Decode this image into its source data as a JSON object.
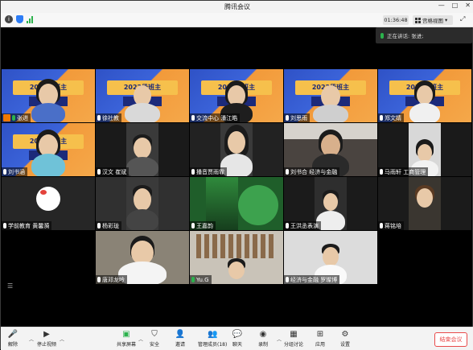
{
  "window": {
    "title": "腾讯会议"
  },
  "infobar": {
    "timer": "01:36:48",
    "view_label": "宫格视图"
  },
  "speaking": {
    "label": "正在讲话: 张进;"
  },
  "tiles": [
    {
      "name": "张进",
      "style": "banner",
      "host": true
    },
    {
      "name": "徐社教",
      "style": "banner"
    },
    {
      "name": "交流中心 潘江皓",
      "style": "banner"
    },
    {
      "name": "刘思雨",
      "style": "banner"
    },
    {
      "name": "郑文婧",
      "style": "banner"
    },
    {
      "name": "刘书涵",
      "style": "banner"
    },
    {
      "name": "汉文 崔斌",
      "style": "dark"
    },
    {
      "name": "播音贾雨霏",
      "style": "dark"
    },
    {
      "name": "刘书合 经济与金融",
      "style": "room"
    },
    {
      "name": "马雨轩 工商管理",
      "style": "dark"
    },
    {
      "name": "学前教育 黄馨漪",
      "style": "avatar"
    },
    {
      "name": "杨彩珑",
      "style": "dark"
    },
    {
      "name": "王嘉韵",
      "style": "green"
    },
    {
      "name": "王洪丞表演",
      "style": "dark"
    },
    {
      "name": "蒋铭培",
      "style": "dark"
    },
    {
      "name": "唐邓龙吟",
      "style": "room"
    },
    {
      "name": "Yu.G",
      "style": "shelf"
    },
    {
      "name": "经济与金融 罗璨博",
      "style": "bright"
    }
  ],
  "toolbar": {
    "mute": "解除",
    "video": "停止视频",
    "share": "共享屏幕",
    "security": "安全",
    "invite": "邀请",
    "members": "管理成员(18)",
    "chat": "聊天",
    "record": "录制",
    "breakout": "分组讨论",
    "apps": "应用",
    "settings": "设置",
    "end": "结束会议"
  }
}
